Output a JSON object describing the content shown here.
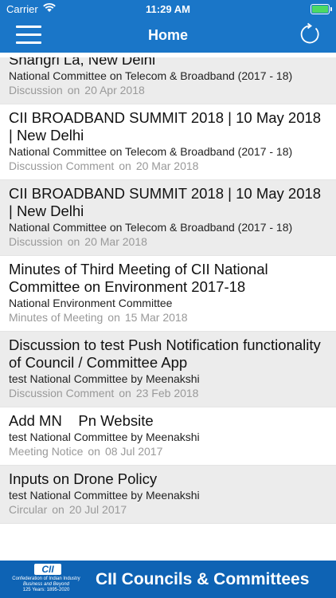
{
  "status_bar": {
    "carrier": "Carrier",
    "time": "11:29 AM"
  },
  "header": {
    "title": "Home"
  },
  "items": [
    {
      "title": "Shangri La, New Delhi",
      "committee": "National Committee on Telecom & Broadband (2017 - 18)",
      "type": "Discussion",
      "on": "on",
      "date": "20 Apr 2018"
    },
    {
      "title": "CII BROADBAND SUMMIT 2018 | 10 May 2018 | New Delhi",
      "committee": "National Committee on Telecom & Broadband (2017 - 18)",
      "type": "Discussion Comment",
      "on": "on",
      "date": "20 Mar 2018"
    },
    {
      "title": "CII BROADBAND SUMMIT 2018 | 10 May 2018 | New Delhi",
      "committee": "National Committee on Telecom & Broadband (2017 - 18)",
      "type": "Discussion",
      "on": "on",
      "date": "20 Mar 2018"
    },
    {
      "title": "Minutes of Third Meeting of CII National Committee on Environment 2017-18",
      "committee": "National Environment Committee",
      "type": "Minutes of Meeting",
      "on": "on",
      "date": "15 Mar 2018"
    },
    {
      "title": "Discussion to test Push Notification functionality of Council / Committee App",
      "committee": "test National Committee by Meenakshi",
      "type": "Discussion Comment",
      "on": "on",
      "date": "23 Feb 2018"
    },
    {
      "title": "Add MN    Pn Website",
      "committee": "test National Committee by Meenakshi",
      "type": "Meeting Notice",
      "on": "on",
      "date": "08 Jul 2017"
    },
    {
      "title": "Inputs on Drone Policy",
      "committee": "test National Committee by Meenakshi",
      "type": "Circular",
      "on": "on",
      "date": "20 Jul 2017"
    }
  ],
  "footer": {
    "logo_text": "CII",
    "tagline_1": "Confederation of Indian Industry",
    "tagline_2": "Business and Beyond",
    "tagline_3": "125 Years: 1895-2020",
    "brand": "CII Councils & Committees"
  },
  "colors": {
    "primary": "#1a76c8",
    "footer": "#0e63b4",
    "alt_row": "#ececec",
    "meta_text": "#999999"
  }
}
